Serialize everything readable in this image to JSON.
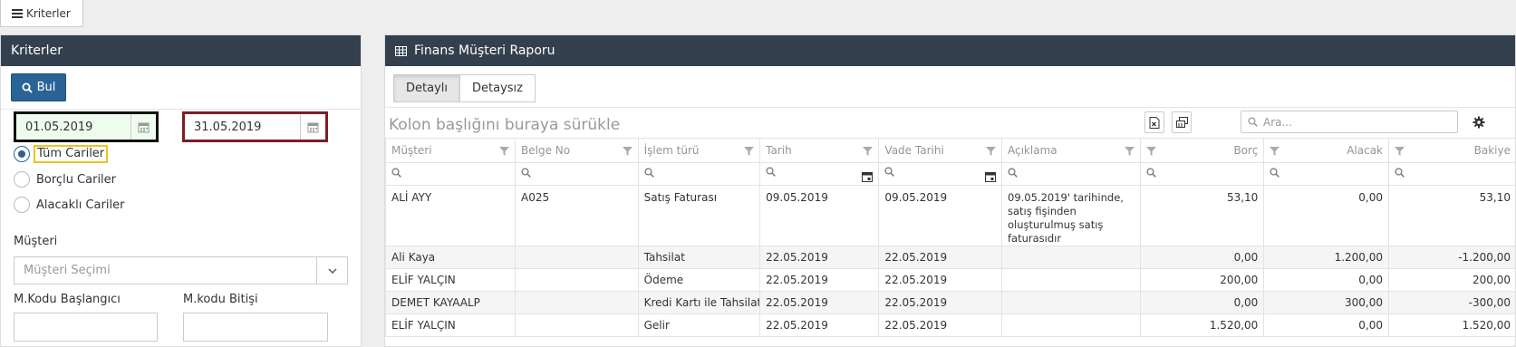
{
  "top_button": {
    "label": "Kriterler",
    "icon": "hamburger-icon"
  },
  "criteria": {
    "title": "Kriterler",
    "find_button": "Bul",
    "start_date": "01.05.2019",
    "end_date": "31.05.2019",
    "radio_options": [
      {
        "label": "Tüm Cariler",
        "selected": true
      },
      {
        "label": "Borçlu Cariler",
        "selected": false
      },
      {
        "label": "Alacaklı Cariler",
        "selected": false
      }
    ],
    "customer_label": "Müşteri",
    "customer_placeholder": "Müşteri Seçimi",
    "code_start_label": "M.Kodu Başlangıcı",
    "code_end_label": "M.kodu Bitişi",
    "highlight_colors": {
      "start_date": "#111111",
      "end_date": "#7a1f24",
      "all_customers": "#f0c419",
      "start_date_bg": "#eefcee"
    }
  },
  "report": {
    "title": "Finans Müşteri Raporu",
    "tabs": [
      {
        "label": "Detaylı",
        "active": true
      },
      {
        "label": "Detaysız",
        "active": false
      }
    ],
    "group_hint": "Kolon başlığını buraya sürükle",
    "search_placeholder": "Ara...",
    "columns": [
      "Müşteri",
      "Belge No",
      "İşlem türü",
      "Tarih",
      "Vade Tarihi",
      "Açıklama",
      "Borç",
      "Alacak",
      "Bakiye"
    ],
    "rows": [
      {
        "musteri": "ALİ AYY",
        "belge": "A025",
        "islem": "Satış Faturası",
        "tarih": "09.05.2019",
        "vade": "09.05.2019",
        "aciklama": "09.05.2019' tarihinde, satış fişinden oluşturulmuş satış faturasıdır",
        "borc": "53,10",
        "alacak": "0,00",
        "bakiye": "53,10"
      },
      {
        "musteri": "Ali Kaya",
        "belge": "",
        "islem": "Tahsilat",
        "tarih": "22.05.2019",
        "vade": "22.05.2019",
        "aciklama": "",
        "borc": "0,00",
        "alacak": "1.200,00",
        "bakiye": "-1.200,00"
      },
      {
        "musteri": "ELİF YALÇIN",
        "belge": "",
        "islem": "Ödeme",
        "tarih": "22.05.2019",
        "vade": "22.05.2019",
        "aciklama": "",
        "borc": "200,00",
        "alacak": "0,00",
        "bakiye": "200,00"
      },
      {
        "musteri": "DEMET KAYAALP",
        "belge": "",
        "islem": "Kredi Kartı ile Tahsilat",
        "tarih": "22.05.2019",
        "vade": "22.05.2019",
        "aciklama": "",
        "borc": "0,00",
        "alacak": "300,00",
        "bakiye": "-300,00"
      },
      {
        "musteri": "ELİF YALÇIN",
        "belge": "",
        "islem": "Gelir",
        "tarih": "22.05.2019",
        "vade": "22.05.2019",
        "aciklama": "",
        "borc": "1.520,00",
        "alacak": "0,00",
        "bakiye": "1.520,00"
      }
    ]
  },
  "colors": {
    "header_bg": "#34404e",
    "primary": "#2a6496"
  }
}
